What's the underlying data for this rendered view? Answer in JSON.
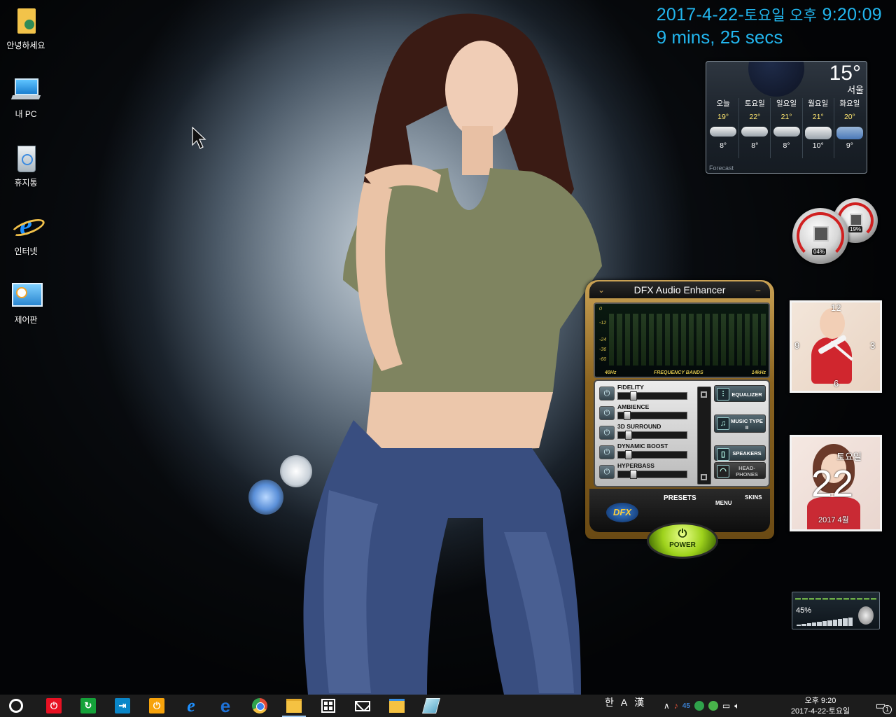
{
  "desktop": {
    "icons": [
      {
        "label": "안녕하세요",
        "icon": "user-folder-icon"
      },
      {
        "label": "내 PC",
        "icon": "computer-icon"
      },
      {
        "label": "휴지통",
        "icon": "recycle-bin-icon"
      },
      {
        "label": "인터넷",
        "icon": "internet-explorer-icon"
      },
      {
        "label": "제어판",
        "icon": "control-panel-icon"
      }
    ]
  },
  "clock_gadget": {
    "date": "2017-4-22-",
    "day_time_label": "토요일 오후",
    "time": "9:20:09",
    "uptime": "9 mins, 25 secs",
    "color": "#22b6ee"
  },
  "weather": {
    "current_temp": "15°",
    "city": "서울",
    "days": [
      {
        "name": "오늘",
        "high": "19°",
        "low": "8°",
        "icon": "cloudy-icon"
      },
      {
        "name": "토요일",
        "high": "22°",
        "low": "8°",
        "icon": "cloudy-icon"
      },
      {
        "name": "일요일",
        "high": "21°",
        "low": "8°",
        "icon": "cloudy-icon"
      },
      {
        "name": "월요일",
        "high": "21°",
        "low": "10°",
        "icon": "cloudy-icon"
      },
      {
        "name": "화요일",
        "high": "20°",
        "low": "9°",
        "icon": "rain-icon"
      }
    ],
    "footer": "Forecast"
  },
  "gauges": {
    "cpu": "04%",
    "memory": "19%"
  },
  "analog_clock": {
    "numbers": [
      "12",
      "3",
      "6",
      "9"
    ]
  },
  "calendar_widget": {
    "weekday": "토요일",
    "day": "22",
    "month": "2017 4월"
  },
  "dfx": {
    "title": "DFX Audio Enhancer",
    "display": {
      "db_labels": [
        "0",
        "-12",
        "-24",
        "-36",
        "-60"
      ],
      "left_label": "40Hz",
      "center_label": "FREQUENCY BANDS",
      "right_label": "14kHz"
    },
    "controls": [
      {
        "name": "FIDELITY",
        "level": 0.2
      },
      {
        "name": "AMBIENCE",
        "level": 0.1
      },
      {
        "name": "3D SURROUND",
        "level": 0.12
      },
      {
        "name": "DYNAMIC BOOST",
        "level": 0.12
      },
      {
        "name": "HYPERBASS",
        "level": 0.2
      }
    ],
    "side_buttons": {
      "equalizer": "EQUALIZER",
      "music_type": "MUSIC TYPE II",
      "speakers": "SPEAKERS",
      "headphones": "HEAD-PHONES"
    },
    "bottom": {
      "logo": "DFX",
      "presets": "PRESETS",
      "menu": "MENU",
      "skins": "SKINS",
      "power": "POWER"
    }
  },
  "volume_widget": {
    "level": "45%"
  },
  "taskbar": {
    "apps": [
      {
        "icon": "cortana-icon",
        "color": "#1c1c1c"
      },
      {
        "icon": "shutdown-icon",
        "color": "#e81123"
      },
      {
        "icon": "restart-icon",
        "color": "#15a23a"
      },
      {
        "icon": "logoff-icon",
        "color": "#0a86c8"
      },
      {
        "icon": "sleep-icon",
        "color": "#f7a30b"
      },
      {
        "icon": "internet-explorer-icon",
        "color": "#1e90ff"
      },
      {
        "icon": "edge-icon",
        "color": "#1e72d8"
      },
      {
        "icon": "chrome-icon",
        "color": "#e04a36"
      },
      {
        "icon": "file-explorer-icon",
        "color": "#f5c242"
      },
      {
        "icon": "store-icon",
        "color": "#ffffff"
      },
      {
        "icon": "mail-icon",
        "color": "#ffffff"
      },
      {
        "icon": "folder-icon",
        "color": "#f5c242"
      },
      {
        "icon": "tablet-icon",
        "color": "#8fd1e6"
      }
    ],
    "ime": [
      "한",
      "A",
      "漢"
    ],
    "clock_time": "오후 9:20",
    "clock_date": "2017-4-22-토요일",
    "notification_count": "1"
  }
}
